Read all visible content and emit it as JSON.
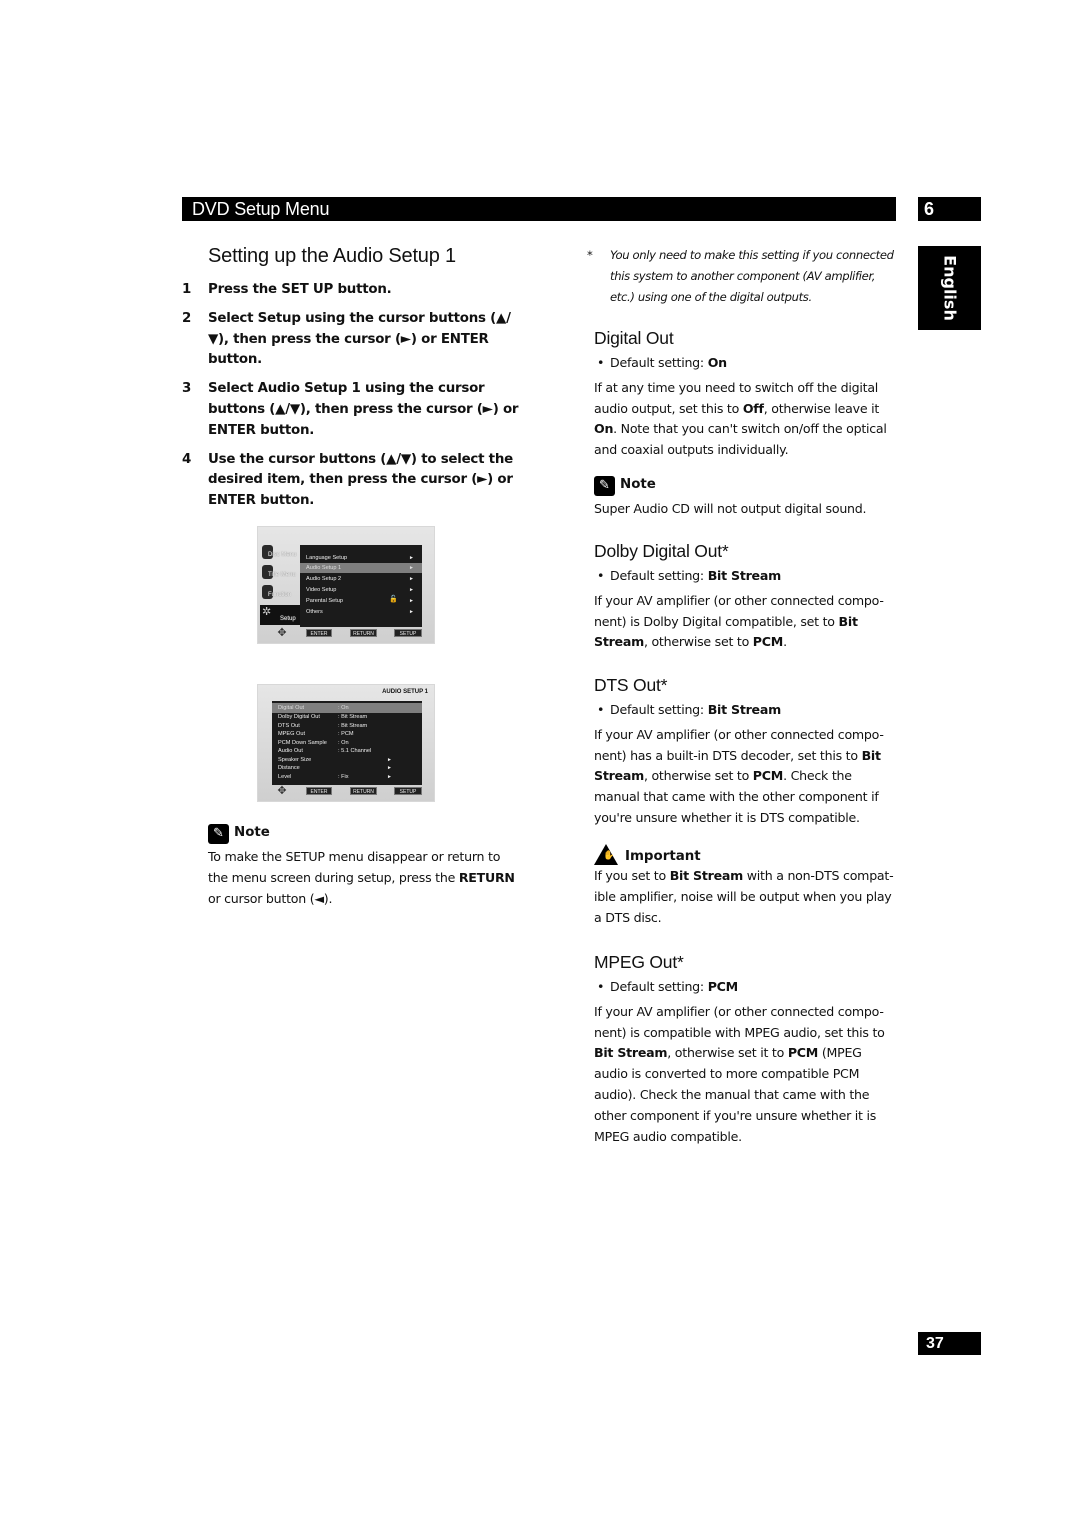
{
  "header": {
    "title": "DVD Setup Menu",
    "chapter": "6",
    "language_tab": "English"
  },
  "left": {
    "title": "Setting up the Audio Setup 1",
    "steps": [
      {
        "num": "1",
        "html": "Press the SET UP button."
      },
      {
        "num": "2",
        "html": "Select <b>Setup</b> using the cursor buttons (▲/▼), then press the cursor (►) or ENTER button."
      },
      {
        "num": "3",
        "html": "Select <b>Audio Setup 1</b> using the cursor buttons (▲/▼), then press the cursor (►) or ENTER button."
      },
      {
        "num": "4",
        "html": "Use the cursor buttons (▲/▼) to select the desired item, then press the cursor (►) or ENTER button."
      }
    ],
    "screen1": {
      "sidebar": [
        "Disc Menu",
        "Title Menu",
        "Function",
        "Setup"
      ],
      "menu": [
        {
          "label": "Language Setup",
          "arrow": "►"
        },
        {
          "label": "Audio Setup 1",
          "arrow": "►",
          "selected": true
        },
        {
          "label": "Audio Setup 2",
          "arrow": "►"
        },
        {
          "label": "Video Setup",
          "arrow": "►"
        },
        {
          "label": "Parental Setup",
          "arrow": "►",
          "lock": true
        },
        {
          "label": "Others",
          "arrow": "►"
        }
      ],
      "buttons": [
        "ENTER",
        "RETURN",
        "SETUP"
      ]
    },
    "screen2": {
      "title": "AUDIO SETUP 1",
      "rows": [
        {
          "label": "Digital Out",
          "value": ": On",
          "selected": true
        },
        {
          "label": "Dolby Digital Out",
          "value": ": Bit Stream"
        },
        {
          "label": "DTS Out",
          "value": ": Bit Stream"
        },
        {
          "label": "MPEG Out",
          "value": ": PCM"
        },
        {
          "label": "PCM Down Sample",
          "value": ": On"
        },
        {
          "label": "Audio Out",
          "value": ": 5.1 Channel"
        },
        {
          "label": "Speaker Size",
          "value": "",
          "arrow": "►"
        },
        {
          "label": "Distance",
          "value": "",
          "arrow": "►"
        },
        {
          "label": "Level",
          "value": ": Fix",
          "arrow": "►"
        }
      ],
      "buttons": [
        "ENTER",
        "RETURN",
        "SETUP"
      ]
    },
    "note": {
      "label": "Note",
      "html": "To make the SETUP menu disappear or return to the menu screen during setup, press the <b>RETURN</b> or cursor button (◄)."
    }
  },
  "right": {
    "footnote": "You only need to make this setting if you connected this system to another component (AV amplifier, etc.) using one of the digital outputs.",
    "footnote_mark": "*",
    "digital_out": {
      "title": "Digital Out",
      "default_html": "Default setting: <b>On</b>",
      "body_html": "If at any time you need to switch off the digital audio output, set this to <b>Off</b>, otherwise leave it <b>On</b>. Note that you can't switch on/off the optical and coaxial outputs individually."
    },
    "note": {
      "label": "Note",
      "text": "Super Audio CD will not output digital sound."
    },
    "dolby_out": {
      "title": "Dolby Digital Out*",
      "default_html": "Default setting: <b>Bit Stream</b>",
      "body_html": "If your AV amplifier (or other connected compo-nent) is Dolby Digital compatible, set to <b>Bit Stream</b>, otherwise set to <b>PCM</b>."
    },
    "dts_out": {
      "title": "DTS Out*",
      "default_html": "Default setting: <b>Bit Stream</b>",
      "body_html": "If your AV amplifier (or other connected compo-nent) has a built-in DTS decoder, set this to <b>Bit Stream</b>, otherwise set to <b>PCM</b>. Check the manual that came with the other component if you're unsure whether it is DTS compatible."
    },
    "important": {
      "label": "Important",
      "html": "If you set to <b>Bit Stream</b> with a non-DTS compat-ible amplifier, noise will be output when you play a DTS disc."
    },
    "mpeg_out": {
      "title": "MPEG Out*",
      "default_html": "Default setting: <b>PCM</b>",
      "body_html": "If your AV amplifier (or other connected compo-nent) is compatible with MPEG audio, set this to <b>Bit Stream</b>, otherwise set it to <b>PCM</b> (MPEG audio is converted to more compatible PCM audio). Check the manual that came with the other component if you're unsure whether it is MPEG audio compatible."
    }
  },
  "footer": {
    "page_number": "37"
  }
}
